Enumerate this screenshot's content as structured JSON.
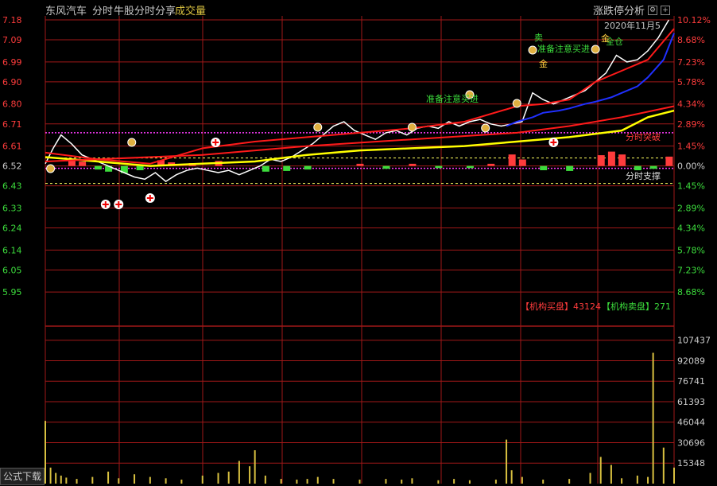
{
  "header": {
    "stock_name": "东风汽车",
    "mode": "分时",
    "formula_name": "牛股分时分享",
    "volume_label": "成交量",
    "tool_label": "涨跌停分析",
    "settings_glyph": "⚙",
    "close_glyph": "+"
  },
  "date_text": "2020年11月5",
  "formula_download_label": "公式下载",
  "institution": {
    "buy_label": "【机构买盘】",
    "buy_value": "43124",
    "sell_label": "【机构卖盘】",
    "sell_value": "271"
  },
  "annotations": {
    "ready_buy_1": "准备注意买进",
    "ready_buy_2": "准备注意买进",
    "sell_label": "卖",
    "full_position": "全仓",
    "breakthrough": "分时突破",
    "support": "分时支撑",
    "gold_a": "金",
    "gold_b": "金"
  },
  "colors": {
    "background": "#000000",
    "grid": "#a01818",
    "up": "#ff3c3c",
    "down": "#3cdc3c",
    "price_line": "#ffffff",
    "avg_line": "#ffff00",
    "ma_red": "#ff1a1a",
    "blue_line": "#2030ff",
    "volume_bar": "#d8c040",
    "magenta": "#ff3cff"
  },
  "chart_data": [
    {
      "type": "line",
      "title": "分时",
      "y_left_ticks": [
        "7.18",
        "7.09",
        "6.99",
        "6.90",
        "6.80",
        "6.71",
        "6.61",
        "6.52",
        "6.43",
        "6.33",
        "6.24",
        "6.14",
        "6.05",
        "5.95"
      ],
      "y_right_ticks": [
        "10.12%",
        "8.68%",
        "7.23%",
        "5.78%",
        "4.34%",
        "2.89%",
        "1.45%",
        "0.00%",
        "1.45%",
        "2.89%",
        "4.34%",
        "5.78%",
        "7.23%",
        "8.68%"
      ],
      "ylim": [
        5.85,
        7.18
      ],
      "prev_close": 6.52,
      "series": [
        {
          "name": "price",
          "color": "#ffffff",
          "x": [
            0,
            3,
            6,
            10,
            14,
            18,
            22,
            26,
            30,
            34,
            38,
            42,
            46,
            50,
            54,
            58,
            62,
            66,
            70,
            74,
            78,
            82,
            86,
            90,
            94,
            98,
            102,
            106,
            110,
            114,
            118,
            122,
            126,
            130,
            134,
            138,
            142,
            146,
            150,
            154,
            158,
            162,
            166,
            170,
            174,
            178,
            182,
            186,
            190,
            194,
            198,
            202,
            206,
            210,
            214,
            218,
            222,
            226,
            230,
            234,
            238
          ],
          "values": [
            6.53,
            6.6,
            6.66,
            6.62,
            6.57,
            6.55,
            6.53,
            6.51,
            6.49,
            6.47,
            6.46,
            6.49,
            6.45,
            6.48,
            6.5,
            6.51,
            6.5,
            6.49,
            6.5,
            6.48,
            6.5,
            6.52,
            6.55,
            6.54,
            6.56,
            6.59,
            6.62,
            6.66,
            6.7,
            6.72,
            6.68,
            6.66,
            6.64,
            6.67,
            6.68,
            6.66,
            6.69,
            6.7,
            6.69,
            6.72,
            6.7,
            6.72,
            6.73,
            6.71,
            6.7,
            6.71,
            6.72,
            6.85,
            6.82,
            6.8,
            6.82,
            6.84,
            6.86,
            6.9,
            6.94,
            7.02,
            6.99,
            7.0,
            7.04,
            7.1,
            7.18
          ]
        },
        {
          "name": "avg",
          "color": "#ffff00",
          "x": [
            0,
            20,
            40,
            60,
            80,
            100,
            120,
            140,
            160,
            180,
            200,
            220,
            230,
            240
          ],
          "values": [
            6.56,
            6.54,
            6.52,
            6.53,
            6.54,
            6.57,
            6.59,
            6.6,
            6.61,
            6.63,
            6.65,
            6.68,
            6.74,
            6.77
          ]
        },
        {
          "name": "ma_red",
          "color": "#ff1a1a",
          "x": [
            0,
            20,
            40,
            60,
            80,
            100,
            120,
            140,
            160,
            180,
            190,
            200,
            210,
            220,
            230,
            240
          ],
          "values": [
            6.58,
            6.55,
            6.53,
            6.6,
            6.63,
            6.65,
            6.67,
            6.69,
            6.72,
            6.79,
            6.8,
            6.82,
            6.9,
            6.95,
            7.0,
            7.14
          ]
        },
        {
          "name": "ma_red2",
          "color": "#ff1a1a",
          "x": [
            0,
            60,
            100,
            140,
            180,
            200,
            220,
            240
          ],
          "values": [
            6.54,
            6.57,
            6.61,
            6.64,
            6.67,
            6.7,
            6.74,
            6.79
          ]
        },
        {
          "name": "blue",
          "color": "#2030ff",
          "x": [
            176,
            180,
            186,
            190,
            196,
            200,
            206,
            210,
            216,
            220,
            226,
            230,
            236,
            240
          ],
          "values": [
            6.7,
            6.72,
            6.74,
            6.76,
            6.77,
            6.78,
            6.8,
            6.81,
            6.83,
            6.85,
            6.88,
            6.92,
            7.0,
            7.12
          ]
        }
      ],
      "osc": [
        {
          "x": 10,
          "v": 1.0
        },
        {
          "x": 14,
          "v": 0.6
        },
        {
          "x": 20,
          "v": -0.5
        },
        {
          "x": 24,
          "v": -0.8
        },
        {
          "x": 30,
          "v": -1.0
        },
        {
          "x": 36,
          "v": -0.6
        },
        {
          "x": 44,
          "v": 0.8
        },
        {
          "x": 48,
          "v": 0.5
        },
        {
          "x": 56,
          "v": 0.4
        },
        {
          "x": 66,
          "v": 0.7
        },
        {
          "x": 84,
          "v": -0.8
        },
        {
          "x": 92,
          "v": -0.7
        },
        {
          "x": 100,
          "v": -0.5
        },
        {
          "x": 120,
          "v": 0.3
        },
        {
          "x": 130,
          "v": -0.4
        },
        {
          "x": 140,
          "v": 0.3
        },
        {
          "x": 150,
          "v": -0.3
        },
        {
          "x": 162,
          "v": -0.3
        },
        {
          "x": 170,
          "v": 0.3
        },
        {
          "x": 178,
          "v": 1.6
        },
        {
          "x": 182,
          "v": 0.9
        },
        {
          "x": 190,
          "v": -0.6
        },
        {
          "x": 200,
          "v": -0.7
        },
        {
          "x": 212,
          "v": 1.5
        },
        {
          "x": 216,
          "v": 2.0
        },
        {
          "x": 220,
          "v": 1.6
        },
        {
          "x": 226,
          "v": -0.6
        },
        {
          "x": 232,
          "v": -0.4
        },
        {
          "x": 238,
          "v": 1.3
        }
      ]
    },
    {
      "type": "bar",
      "title": "成交量",
      "y_ticks": [
        "107437",
        "92089",
        "76741",
        "61393",
        "46044",
        "30696",
        "15348"
      ],
      "ylim": [
        0,
        115000
      ],
      "x": [
        0,
        2,
        4,
        6,
        8,
        12,
        18,
        24,
        28,
        34,
        40,
        46,
        52,
        60,
        66,
        70,
        74,
        78,
        80,
        84,
        90,
        96,
        100,
        104,
        110,
        120,
        130,
        136,
        140,
        150,
        156,
        162,
        172,
        176,
        178,
        182,
        190,
        200,
        208,
        212,
        216,
        220,
        226,
        230,
        232,
        236,
        240
      ],
      "values": [
        47000,
        12000,
        8000,
        6000,
        4500,
        3500,
        5000,
        9000,
        4000,
        7000,
        5000,
        4000,
        3000,
        6000,
        8000,
        9000,
        17000,
        13000,
        25000,
        6000,
        3500,
        3000,
        3500,
        5000,
        3500,
        3000,
        3500,
        3000,
        4000,
        2500,
        3500,
        2500,
        3000,
        33000,
        10000,
        5000,
        3000,
        3500,
        8000,
        20000,
        14000,
        4000,
        6000,
        5000,
        98000,
        27000,
        12000
      ]
    }
  ]
}
